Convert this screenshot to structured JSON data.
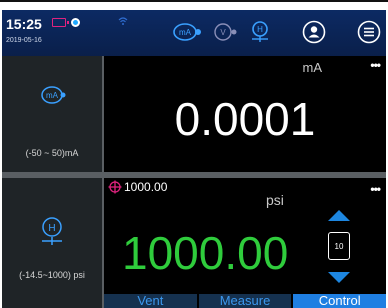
{
  "status": {
    "time": "15:25",
    "date": "2019-05-16"
  },
  "toolbar": {
    "icons": [
      "ma-source-icon",
      "voltage-source-icon",
      "pressure-module-icon",
      "user-icon",
      "menu-icon"
    ],
    "ma_icon_label": "mA",
    "v_icon_label": "V",
    "h_icon_label": "H"
  },
  "channel1": {
    "icon_label": "mA",
    "range": "(-50 ~ 50)mA",
    "unit": "mA",
    "value": "0.0001",
    "menu": "•••"
  },
  "channel2": {
    "icon_label": "H",
    "range": "(-14.5~1000) psi",
    "setpoint": "1000.00",
    "unit": "psi",
    "value": "1000.00",
    "step": "10",
    "menu": "•••"
  },
  "tabs": [
    {
      "label": "Vent",
      "active": false
    },
    {
      "label": "Measure",
      "active": false
    },
    {
      "label": "Control",
      "active": true
    }
  ],
  "colors": {
    "status_bar": "#0c2a63",
    "accent_blue": "#1d86e0",
    "value_green": "#2fcc3c",
    "panel_gray": "#1f2427",
    "battery_pink": "#e0237f"
  }
}
